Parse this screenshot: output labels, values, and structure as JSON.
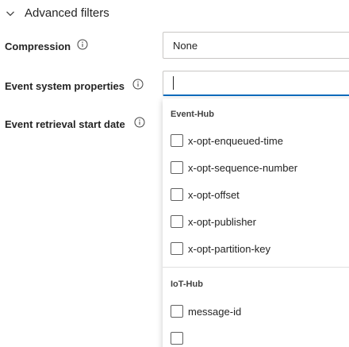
{
  "section": {
    "title": "Advanced filters"
  },
  "fields": {
    "compression": {
      "label": "Compression",
      "value": "None"
    },
    "event_system_properties": {
      "label": "Event system properties",
      "value": ""
    },
    "event_retrieval_start_date": {
      "label": "Event retrieval start date"
    }
  },
  "dropdown": {
    "groups": [
      {
        "header": "Event-Hub",
        "options": [
          {
            "label": "x-opt-enqueued-time",
            "checked": false
          },
          {
            "label": "x-opt-sequence-number",
            "checked": false
          },
          {
            "label": "x-opt-offset",
            "checked": false
          },
          {
            "label": "x-opt-publisher",
            "checked": false
          },
          {
            "label": "x-opt-partition-key",
            "checked": false
          }
        ]
      },
      {
        "header": "IoT-Hub",
        "options": [
          {
            "label": "message-id",
            "checked": false
          },
          {
            "label": "",
            "checked": false
          }
        ]
      }
    ]
  },
  "icons": {
    "chevron": "chevron-down-icon",
    "info": "info-icon"
  },
  "colors": {
    "accent": "#0f6cbd",
    "text": "#242424",
    "border": "#c8c6c4"
  }
}
